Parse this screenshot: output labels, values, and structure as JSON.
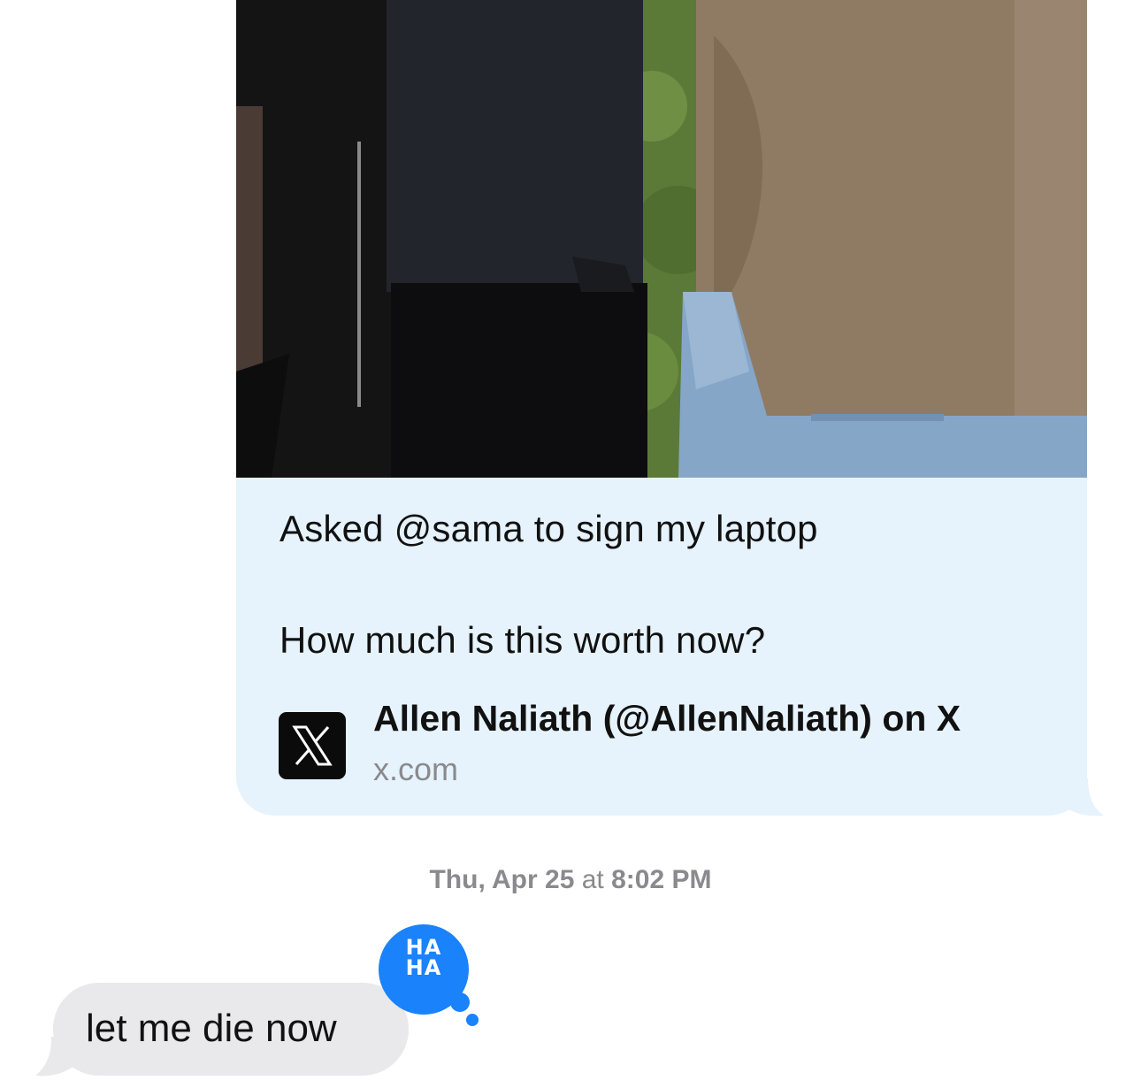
{
  "link_preview": {
    "caption_line_1": "Asked @sama to sign my laptop",
    "caption_line_2": "How much is this worth now?",
    "title": "Allen Naliath (@AllenNaliath) on X",
    "domain": "x.com",
    "site_icon": "x-logo-icon",
    "background_color": "#e6f3fc"
  },
  "timestamp": {
    "day": "Thu, Apr 25",
    "at": "at",
    "time": "8:02 PM"
  },
  "incoming_message": {
    "text": "let me die now",
    "background_color": "#e9e9eb"
  },
  "tapback": {
    "line_1": "HA",
    "line_2": "HA",
    "icon": "haha-reaction-icon",
    "color": "#1a82fb"
  }
}
